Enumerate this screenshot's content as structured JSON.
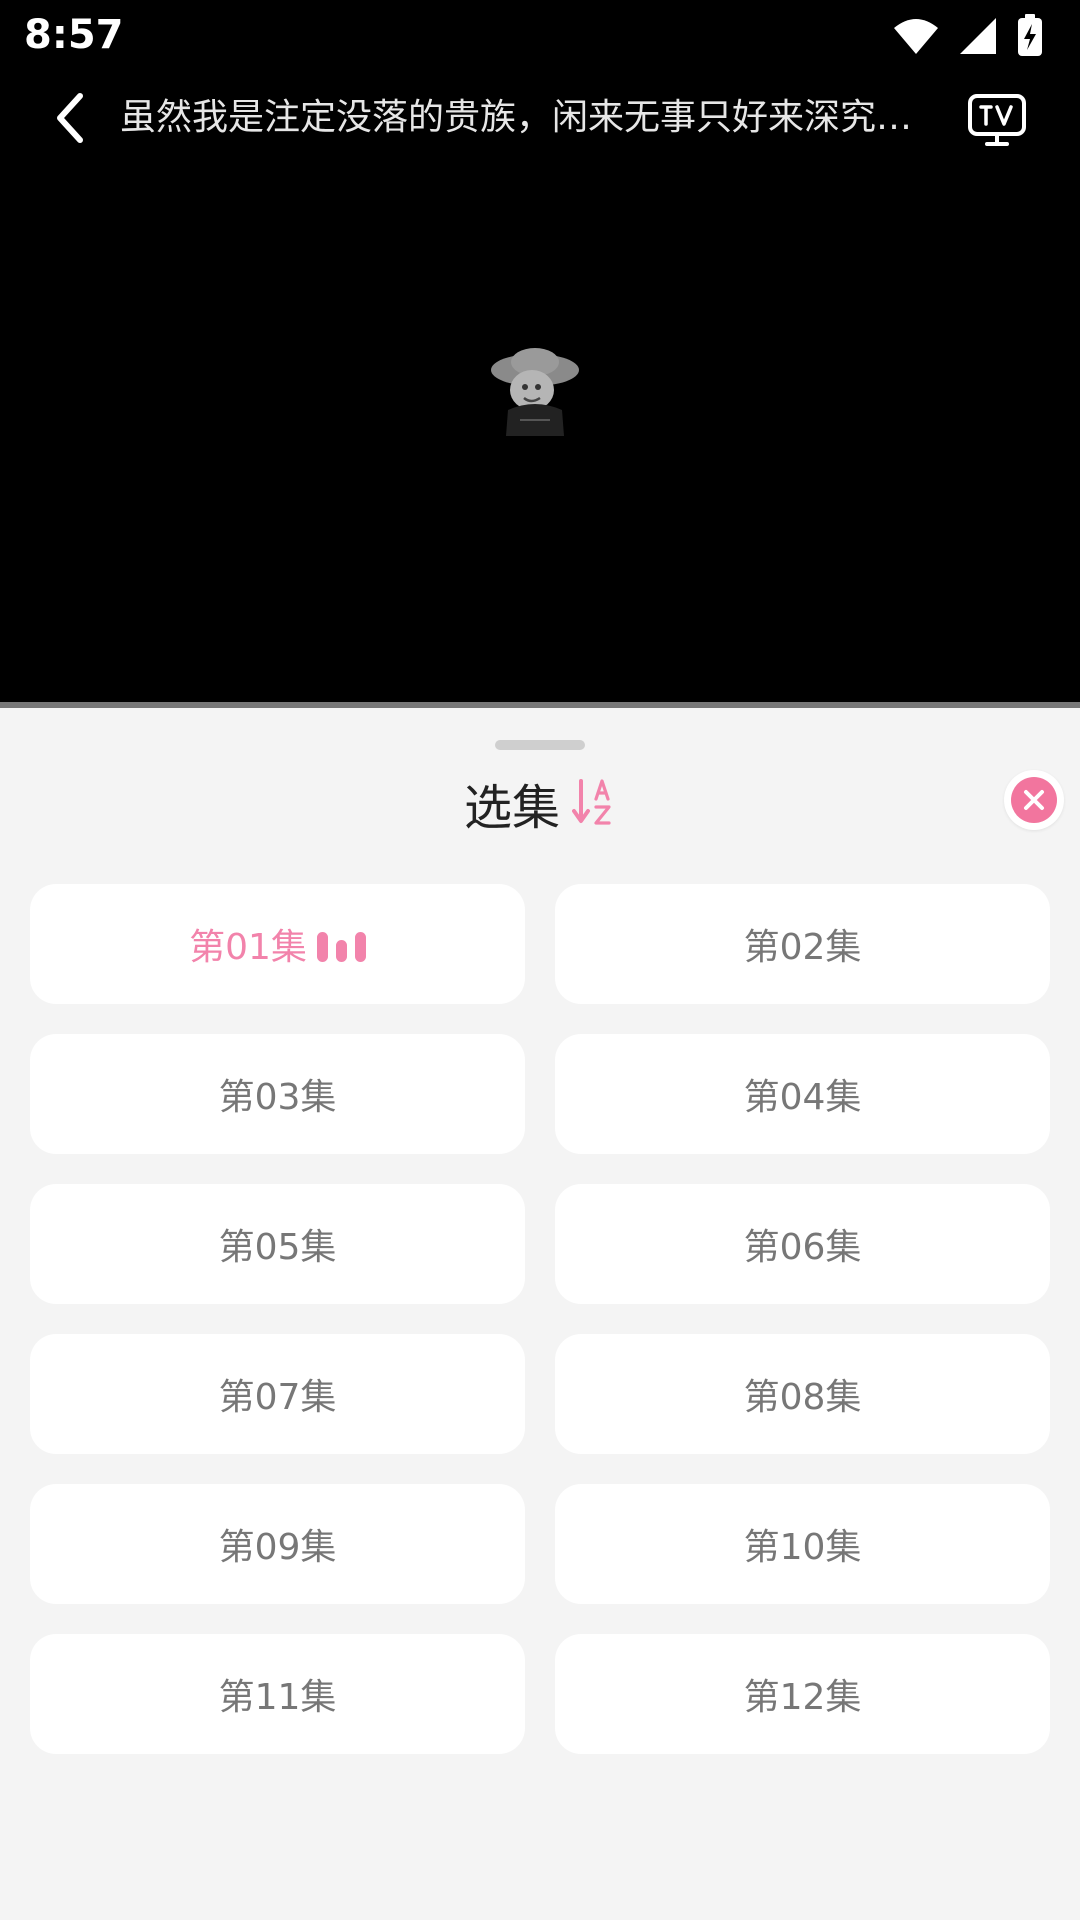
{
  "status_bar": {
    "time": "8:57"
  },
  "player": {
    "title": "虽然我是注定没落的贵族，闲来无事只好来深究魔…"
  },
  "episode_sheet": {
    "title": "选集",
    "current_index": 0,
    "episodes": [
      {
        "label": "第01集"
      },
      {
        "label": "第02集"
      },
      {
        "label": "第03集"
      },
      {
        "label": "第04集"
      },
      {
        "label": "第05集"
      },
      {
        "label": "第06集"
      },
      {
        "label": "第07集"
      },
      {
        "label": "第08集"
      },
      {
        "label": "第09集"
      },
      {
        "label": "第10集"
      },
      {
        "label": "第11集"
      },
      {
        "label": "第12集"
      }
    ]
  },
  "colors": {
    "accent": "#f283ab",
    "close": "#f2759e",
    "sheet_bg": "#f4f4f4"
  },
  "icons": [
    "back-icon",
    "tv-cast-icon",
    "sort-az-icon",
    "close-icon",
    "wifi-icon",
    "signal-icon",
    "battery-charging-icon"
  ]
}
